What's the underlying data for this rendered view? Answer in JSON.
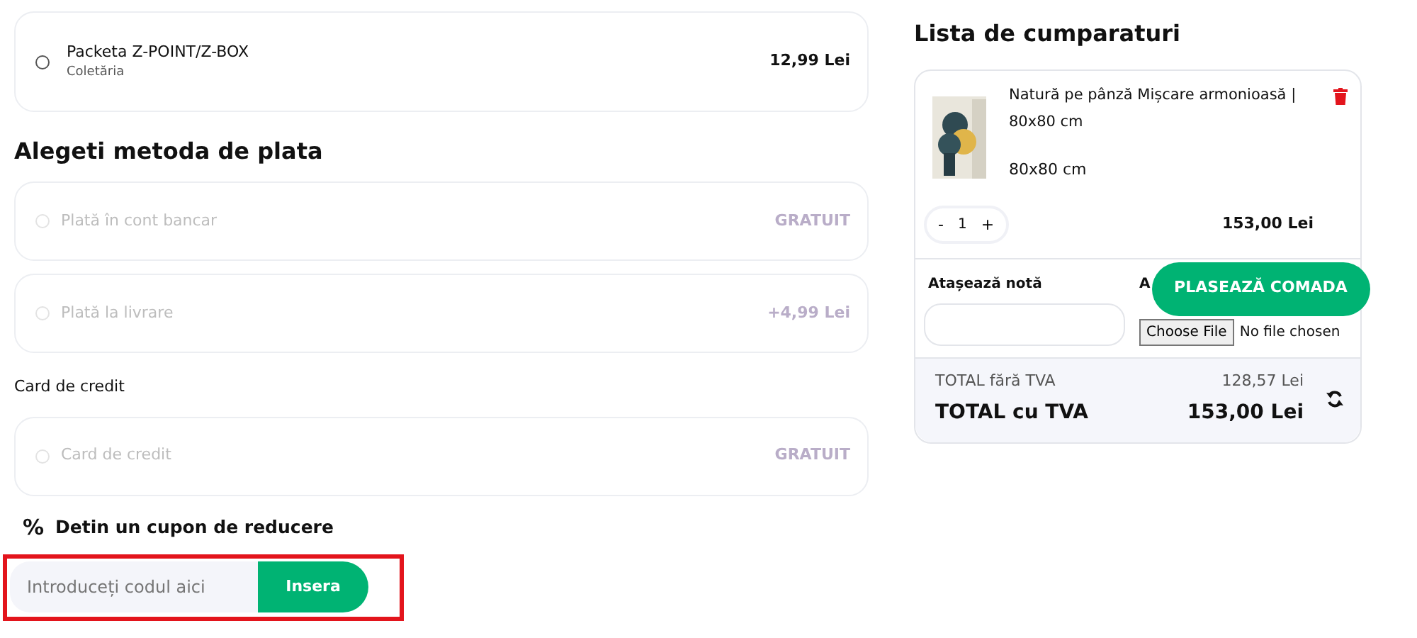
{
  "shipping_options": [
    {
      "name": "Packeta Z-POINT/Z-BOX",
      "subtitle": "Coletăria",
      "price": "12,99 Lei",
      "selected": false
    }
  ],
  "payment_heading": "Alegeti metoda de plata",
  "payment_options": [
    {
      "label": "Plată în cont bancar",
      "price": "GRATUIT",
      "selected": false,
      "disabled": true
    },
    {
      "label": "Plată la livrare",
      "price": "+4,99 Lei",
      "selected": false,
      "disabled": true
    },
    {
      "group_label": "Card de credit",
      "label": "Card de credit",
      "price": "GRATUIT",
      "selected": false,
      "disabled": true
    }
  ],
  "coupon": {
    "icon_text": "%",
    "heading": "Detin un cupon de reducere",
    "placeholder": "Introduceți codul aici",
    "button": "Insera"
  },
  "cart": {
    "title": "Lista de cumparaturi",
    "items": [
      {
        "name": "Natură pe pânză Mișcare armonioasă | 80x80 cm",
        "variant": "80x80 cm",
        "quantity": "1",
        "minus": "-",
        "plus": "+",
        "price": "153,00 Lei"
      }
    ],
    "note_label": "Atașează notă",
    "attach_label": "A",
    "file_button": "Choose File",
    "file_status": "No file chosen",
    "place_order": "PLASEAZĂ COMADA",
    "subtotal_label": "TOTAL fără TVA",
    "subtotal": "128,57 Lei",
    "total_label": "TOTAL cu TVA",
    "total": "153,00 Lei"
  }
}
